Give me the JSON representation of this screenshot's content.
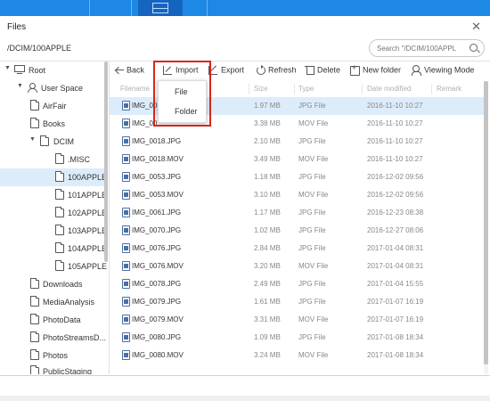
{
  "window": {
    "title": "Files",
    "close_glyph": "✕"
  },
  "pathbar": {
    "path": "/DCIM/100APPLE",
    "search_placeholder": "Search \"/DCIM/100APPL"
  },
  "toolbar": {
    "back": "Back",
    "import": "Import",
    "export": "Export",
    "refresh": "Refresh",
    "delete": "Delete",
    "new_folder": "New folder",
    "viewing_mode": "Viewing Mode"
  },
  "import_menu": {
    "file": "File",
    "folder": "Folder"
  },
  "columns": {
    "filename": "Filename",
    "size": "Size",
    "type": "Type",
    "date_modified": "Date modified",
    "remark": "Remark"
  },
  "tree": [
    {
      "label": "Root",
      "arrow": "▼",
      "icon": "computer-icon"
    },
    {
      "label": "User Space",
      "arrow": "▼",
      "icon": "user-icon"
    },
    {
      "label": "AirFair",
      "icon": "folder-icon"
    },
    {
      "label": "Books",
      "icon": "folder-icon"
    },
    {
      "label": "DCIM",
      "arrow": "▼",
      "icon": "folder-icon"
    },
    {
      "label": ".MISC",
      "icon": "folder-icon"
    },
    {
      "label": "100APPLE",
      "icon": "folder-icon",
      "selected": true
    },
    {
      "label": "101APPLE",
      "icon": "folder-icon"
    },
    {
      "label": "102APPLE",
      "icon": "folder-icon"
    },
    {
      "label": "103APPLE",
      "icon": "folder-icon"
    },
    {
      "label": "104APPLE",
      "icon": "folder-icon"
    },
    {
      "label": "105APPLE",
      "icon": "folder-icon"
    },
    {
      "label": "Downloads",
      "icon": "folder-icon"
    },
    {
      "label": "MediaAnalysis",
      "icon": "folder-icon"
    },
    {
      "label": "PhotoData",
      "icon": "folder-icon"
    },
    {
      "label": "PhotoStreamsD...",
      "icon": "folder-icon"
    },
    {
      "label": "Photos",
      "icon": "folder-icon"
    },
    {
      "label": "PublicStaging",
      "icon": "folder-icon"
    }
  ],
  "files": [
    {
      "name": "IMG_00",
      "size": "1.97 MB",
      "type": "JPG File",
      "date": "2016-11-10 10:27",
      "selected": true
    },
    {
      "name": "IMG_00",
      "size": "3.38 MB",
      "type": "MOV File",
      "date": "2016-11-10 10:27"
    },
    {
      "name": "IMG_0018.JPG",
      "size": "2.10 MB",
      "type": "JPG File",
      "date": "2016-11-10 10:27"
    },
    {
      "name": "IMG_0018.MOV",
      "size": "3.49 MB",
      "type": "MOV File",
      "date": "2016-11-10 10:27"
    },
    {
      "name": "IMG_0053.JPG",
      "size": "1.18 MB",
      "type": "JPG File",
      "date": "2016-12-02 09:56"
    },
    {
      "name": "IMG_0053.MOV",
      "size": "3.10 MB",
      "type": "MOV File",
      "date": "2016-12-02 09:56"
    },
    {
      "name": "IMG_0061.JPG",
      "size": "1.17 MB",
      "type": "JPG File",
      "date": "2016-12-23 08:38"
    },
    {
      "name": "IMG_0070.JPG",
      "size": "1.02 MB",
      "type": "JPG File",
      "date": "2016-12-27 08:06"
    },
    {
      "name": "IMG_0076.JPG",
      "size": "2.84 MB",
      "type": "JPG File",
      "date": "2017-01-04 08:31"
    },
    {
      "name": "IMG_0076.MOV",
      "size": "3.20 MB",
      "type": "MOV File",
      "date": "2017-01-04 08:31"
    },
    {
      "name": "IMG_0078.JPG",
      "size": "2.49 MB",
      "type": "JPG File",
      "date": "2017-01-04 15:55"
    },
    {
      "name": "IMG_0079.JPG",
      "size": "1.61 MB",
      "type": "JPG File",
      "date": "2017-01-07 16:19"
    },
    {
      "name": "IMG_0079.MOV",
      "size": "3.31 MB",
      "type": "MOV File",
      "date": "2017-01-07 16:19"
    },
    {
      "name": "IMG_0080.JPG",
      "size": "1.09 MB",
      "type": "JPG File",
      "date": "2017-01-08 18:34"
    },
    {
      "name": "IMG_0080.MOV",
      "size": "3.24 MB",
      "type": "MOV File",
      "date": "2017-01-08 18:34"
    }
  ],
  "colors": {
    "accent_blue": "#1e88e5",
    "selection": "#dcecfb",
    "highlight_red": "#d9251c"
  }
}
